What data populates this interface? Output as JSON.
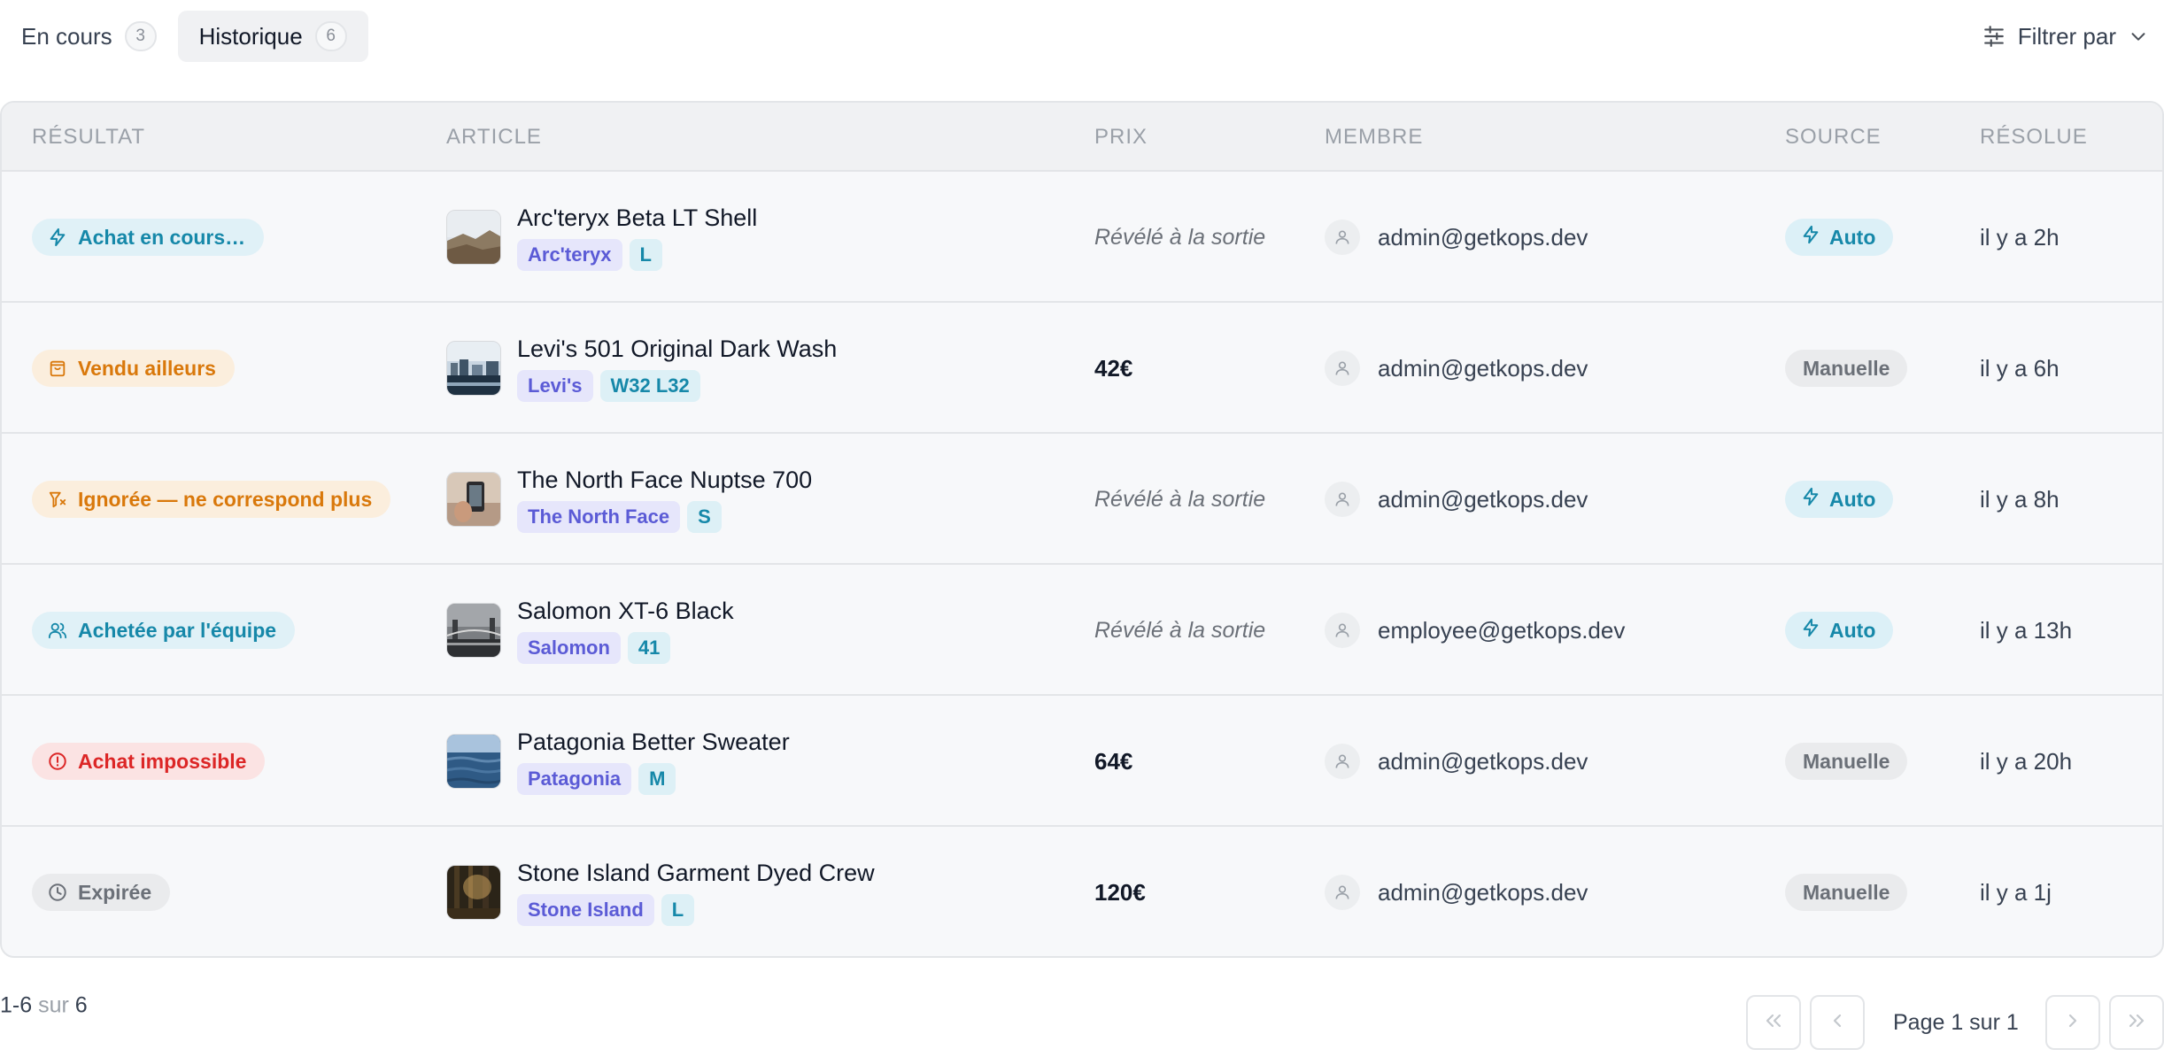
{
  "tabs": [
    {
      "label": "En cours",
      "count": "3",
      "active": false
    },
    {
      "label": "Historique",
      "count": "6",
      "active": true
    }
  ],
  "filter": {
    "label": "Filtrer par",
    "icon": "sliders-icon",
    "chevron": "chevron-down-icon"
  },
  "table": {
    "headers": {
      "resultat": "RÉSULTAT",
      "article": "ARTICLE",
      "prix": "PRIX",
      "membre": "MEMBRE",
      "source": "SOURCE",
      "resolue": "RÉSOLUE"
    },
    "rows": [
      {
        "status": {
          "label": "Achat en cours…",
          "icon": "bolt-icon",
          "tone": "info"
        },
        "article": {
          "title": "Arc'teryx Beta LT Shell",
          "brand": "Arc'teryx",
          "size": "L",
          "thumb": "mountain-thumb"
        },
        "price": "Révélé à la sortie",
        "price_hidden": true,
        "member": "admin@getkops.dev",
        "source": {
          "label": "Auto",
          "type": "auto"
        },
        "resolved": "il y a 2h"
      },
      {
        "status": {
          "label": "Vendu ailleurs",
          "icon": "shopping-bag-icon",
          "tone": "warn"
        },
        "article": {
          "title": "Levi's 501 Original Dark Wash",
          "brand": "Levi's",
          "size": "W32 L32",
          "thumb": "city-thumb"
        },
        "price": "42€",
        "price_hidden": false,
        "member": "admin@getkops.dev",
        "source": {
          "label": "Manuelle",
          "type": "manual"
        },
        "resolved": "il y a 6h"
      },
      {
        "status": {
          "label": "Ignorée — ne correspond plus",
          "icon": "filter-x-icon",
          "tone": "warn"
        },
        "article": {
          "title": "The North Face Nuptse 700",
          "brand": "The North Face",
          "size": "S",
          "thumb": "phone-thumb"
        },
        "price": "Révélé à la sortie",
        "price_hidden": true,
        "member": "admin@getkops.dev",
        "source": {
          "label": "Auto",
          "type": "auto"
        },
        "resolved": "il y a 8h"
      },
      {
        "status": {
          "label": "Achetée par l'équipe",
          "icon": "users-icon",
          "tone": "info"
        },
        "article": {
          "title": "Salomon XT-6 Black",
          "brand": "Salomon",
          "size": "41",
          "thumb": "bridge-thumb"
        },
        "price": "Révélé à la sortie",
        "price_hidden": true,
        "member": "employee@getkops.dev",
        "source": {
          "label": "Auto",
          "type": "auto"
        },
        "resolved": "il y a 13h"
      },
      {
        "status": {
          "label": "Achat impossible",
          "icon": "alert-circle-icon",
          "tone": "danger"
        },
        "article": {
          "title": "Patagonia Better Sweater",
          "brand": "Patagonia",
          "size": "M",
          "thumb": "ocean-thumb"
        },
        "price": "64€",
        "price_hidden": false,
        "member": "admin@getkops.dev",
        "source": {
          "label": "Manuelle",
          "type": "manual"
        },
        "resolved": "il y a 20h"
      },
      {
        "status": {
          "label": "Expirée",
          "icon": "clock-icon",
          "tone": "muted"
        },
        "article": {
          "title": "Stone Island Garment Dyed Crew",
          "brand": "Stone Island",
          "size": "L",
          "thumb": "forest-thumb"
        },
        "price": "120€",
        "price_hidden": false,
        "member": "admin@getkops.dev",
        "source": {
          "label": "Manuelle",
          "type": "manual"
        },
        "resolved": "il y a 1j"
      }
    ]
  },
  "footer": {
    "range_start": "1-6",
    "range_sep": "sur",
    "range_total": "6",
    "page_label": "Page 1 sur 1"
  },
  "colors": {
    "accent_teal": "#1688a9",
    "accent_orange": "#d9780b",
    "accent_red": "#dc2626",
    "brand_purple": "#5b5bd6",
    "muted": "#6b7078"
  }
}
